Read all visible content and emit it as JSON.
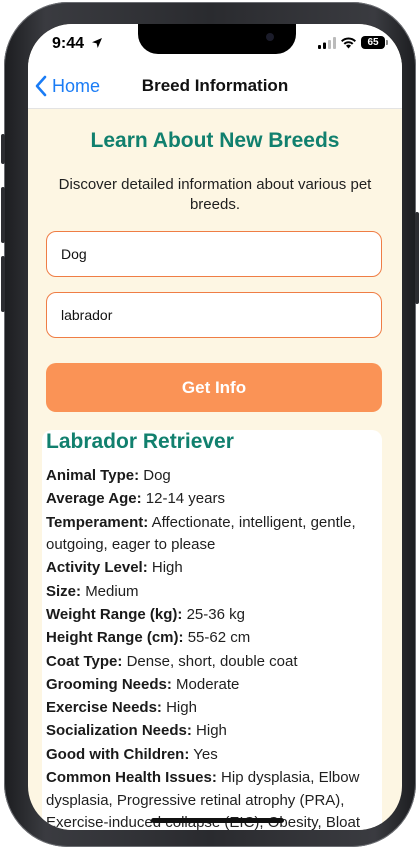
{
  "status_bar": {
    "time": "9:44",
    "battery": "65"
  },
  "nav": {
    "back_label": "Home",
    "title": "Breed Information"
  },
  "main": {
    "title": "Learn About New Breeds",
    "subtitle": "Discover detailed information about various pet breeds.",
    "animal_field": {
      "value": "Dog"
    },
    "breed_field": {
      "value": "labrador"
    },
    "button_label": "Get Info"
  },
  "result": {
    "name": "Labrador Retriever",
    "details": [
      {
        "label": "Animal Type:",
        "value": "Dog"
      },
      {
        "label": "Average Age:",
        "value": "12-14 years"
      },
      {
        "label": "Temperament:",
        "value": "Affectionate, intelligent, gentle, outgoing, eager to please"
      },
      {
        "label": "Activity Level:",
        "value": "High"
      },
      {
        "label": "Size:",
        "value": "Medium"
      },
      {
        "label": "Weight Range (kg):",
        "value": "25-36 kg"
      },
      {
        "label": "Height Range (cm):",
        "value": "55-62 cm"
      },
      {
        "label": "Coat Type:",
        "value": "Dense, short, double coat"
      },
      {
        "label": "Grooming Needs:",
        "value": "Moderate"
      },
      {
        "label": "Exercise Needs:",
        "value": "High"
      },
      {
        "label": "Socialization Needs:",
        "value": "High"
      },
      {
        "label": "Good with Children:",
        "value": "Yes"
      },
      {
        "label": "Common Health Issues:",
        "value": "Hip dysplasia, Elbow dysplasia, Progressive retinal atrophy (PRA), Exercise-induced collapse (EIC), Obesity, Bloat"
      }
    ]
  },
  "colors": {
    "accent_teal": "#11806e",
    "button_orange": "#fa9356",
    "field_border": "#ef7d45",
    "background": "#fdf6e3",
    "link_blue": "#1a7cf5"
  },
  "icons": {
    "back": "chevron-left-icon",
    "location": "location-arrow-icon",
    "signal": "cellular-signal-icon",
    "wifi": "wifi-icon",
    "battery": "battery-icon"
  }
}
